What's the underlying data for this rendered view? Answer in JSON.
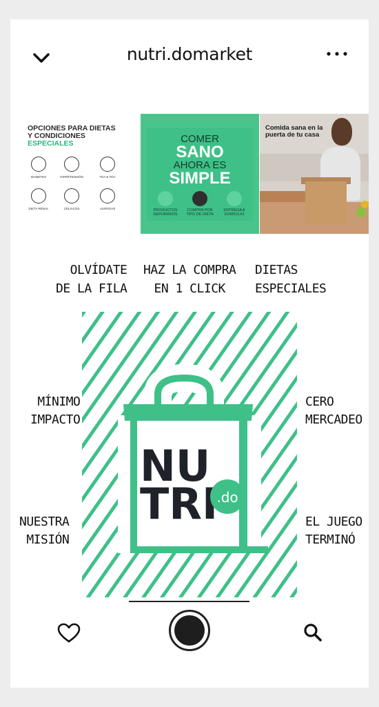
{
  "header": {
    "title": "nutri.domarket",
    "back_icon": "chevron-down-icon",
    "more_icon": "more-horizontal-icon"
  },
  "tiles": {
    "diets": {
      "title_line1": "OPCIONES PARA DIETAS",
      "title_line2": "Y CONDICIONES",
      "title_line3": "ESPECIALES",
      "items": [
        "DIABETES",
        "HIPERTENSIÓN",
        "TEA & TDA",
        "DIETA RENAL",
        "CELÍACOS",
        "ALERGIAS"
      ]
    },
    "promo": {
      "line1": "COMER",
      "line2": "SANO",
      "line3": "AHORA ES",
      "line4": "SIMPLE",
      "features": [
        "PRODUCTOS DEPURADOS",
        "COMPRA POR TIPO DE DIETA",
        "ENTREGA A DOMICILIO"
      ]
    },
    "photo": {
      "caption": "Comida sana en la puerta de tu casa"
    }
  },
  "columns": [
    "OLVÍDATE\nDE LA FILA",
    "HAZ LA COMPRA\nEN 1 CLICK",
    "DIETAS\nESPECIALES"
  ],
  "hero": {
    "logo_line1": "NU",
    "logo_line2": "TRI",
    "logo_badge": ".do"
  },
  "sides": {
    "left_top": "MÍNIMO\nIMPACTO",
    "right_top": "CERO\nMERCADEO",
    "left_bottom": "NUESTRA\nMISIÓN",
    "right_bottom": "EL JUEGO\nTERMINÓ"
  },
  "nav": {
    "icons": [
      "heart-icon",
      "record-button",
      "search-icon"
    ]
  },
  "colors": {
    "brand_green": "#3ec088",
    "dark_text": "#1f2229",
    "background": "#ededee"
  }
}
